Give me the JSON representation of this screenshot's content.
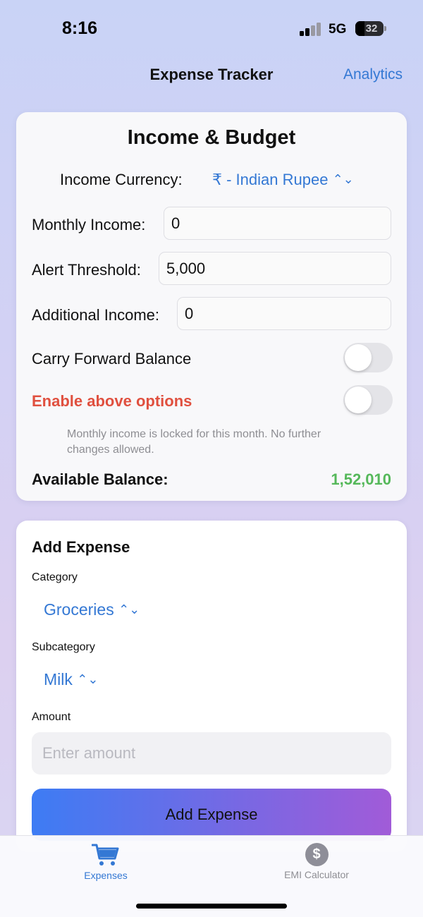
{
  "status_bar": {
    "time": "8:16",
    "network": "5G",
    "battery": "32",
    "battery_level": 0.32
  },
  "nav": {
    "title": "Expense Tracker",
    "right_link": "Analytics"
  },
  "income_card": {
    "title": "Income & Budget",
    "currency_label": "Income Currency:",
    "currency_value": "₹ - Indian Rupee",
    "monthly_income_label": "Monthly Income:",
    "monthly_income_value": "0",
    "alert_threshold_label": "Alert Threshold:",
    "alert_threshold_value": "5,000",
    "additional_income_label": "Additional Income:",
    "additional_income_value": "0",
    "carry_forward_label": "Carry Forward Balance",
    "carry_forward_on": false,
    "enable_options_label": "Enable above options",
    "enable_options_on": false,
    "lock_note": "Monthly income is locked for this month. No further changes allowed.",
    "balance_label": "Available Balance:",
    "balance_value": "1,52,010"
  },
  "expense_card": {
    "title": "Add Expense",
    "category_label": "Category",
    "category_value": "Groceries",
    "subcategory_label": "Subcategory",
    "subcategory_value": "Milk",
    "amount_label": "Amount",
    "amount_placeholder": "Enter amount",
    "add_button": "Add Expense"
  },
  "tabs": [
    {
      "label": "Expenses",
      "icon": "cart-icon",
      "selected": true
    },
    {
      "label": "EMI Calculator",
      "icon": "dollar-icon",
      "symbol": "$",
      "selected": false
    }
  ],
  "colors": {
    "accent": "#3478d4",
    "warning": "#e0503f",
    "positive": "#55b85a"
  }
}
